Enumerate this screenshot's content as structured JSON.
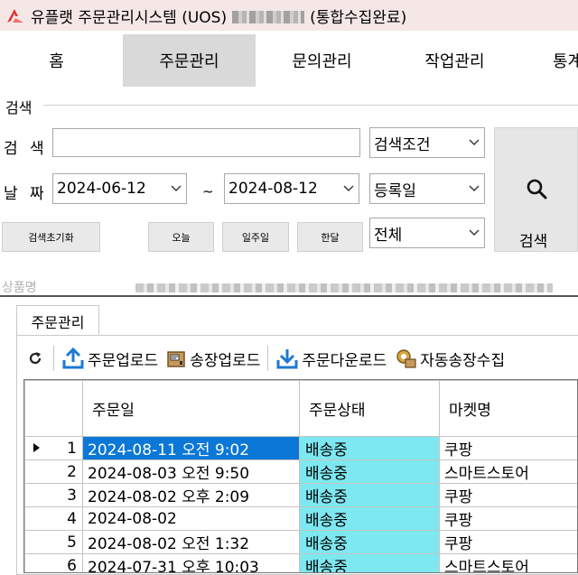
{
  "window": {
    "title_prefix": "유플랫 주문관리시스템 (UOS)",
    "title_suffix": "(통합수집완료)"
  },
  "menu": [
    {
      "label": "홈"
    },
    {
      "label": "주문관리",
      "active": true
    },
    {
      "label": "문의관리"
    },
    {
      "label": "작업관리"
    },
    {
      "label": "통계"
    }
  ],
  "search_group": {
    "title": "검색",
    "keyword_label": "검 색",
    "keyword_value": "",
    "condition_select": "검색조건",
    "date_label": "날 짜",
    "date_from": "2024-06-12",
    "date_to": "2024-08-12",
    "range_separator": "~",
    "date_type_select": "등록일",
    "scope_select": "전체",
    "reset_button": "검색초기화",
    "today_button": "오늘",
    "week_button": "일주일",
    "month_button": "한달",
    "search_button": "검색",
    "clipped_label": "상품명"
  },
  "panel": {
    "tab_label": "주문관리",
    "toolbar": {
      "order_upload": "주문업로드",
      "invoice_upload": "송장업로드",
      "order_download": "주문다운로드",
      "auto_invoice": "자동송장수집"
    }
  },
  "grid": {
    "columns": [
      "주문일",
      "주문상태",
      "마켓명"
    ],
    "rows": [
      {
        "num": "1",
        "date": "2024-08-11 오전 9:02",
        "status": "배송중",
        "market": "쿠팡",
        "selected": true
      },
      {
        "num": "2",
        "date": "2024-08-03 오전 9:50",
        "status": "배송중",
        "market": "스마트스토어"
      },
      {
        "num": "3",
        "date": "2024-08-02 오후 2:09",
        "status": "배송중",
        "market": "쿠팡"
      },
      {
        "num": "4",
        "date": "2024-08-02",
        "status": "배송중",
        "market": "쿠팡"
      },
      {
        "num": "5",
        "date": "2024-08-02 오전 1:32",
        "status": "배송중",
        "market": "쿠팡"
      },
      {
        "num": "6",
        "date": "2024-07-31 오후 10:03",
        "status": "배송중",
        "market": "스마트스토어"
      }
    ]
  },
  "colors": {
    "titlebar_bg": "#f6e7e7",
    "active_tab_bg": "#d9d9d9",
    "status_cell_bg": "#7ee8f1",
    "selection_bg": "#0b78d7",
    "upload_icon": "#1f78d1"
  }
}
